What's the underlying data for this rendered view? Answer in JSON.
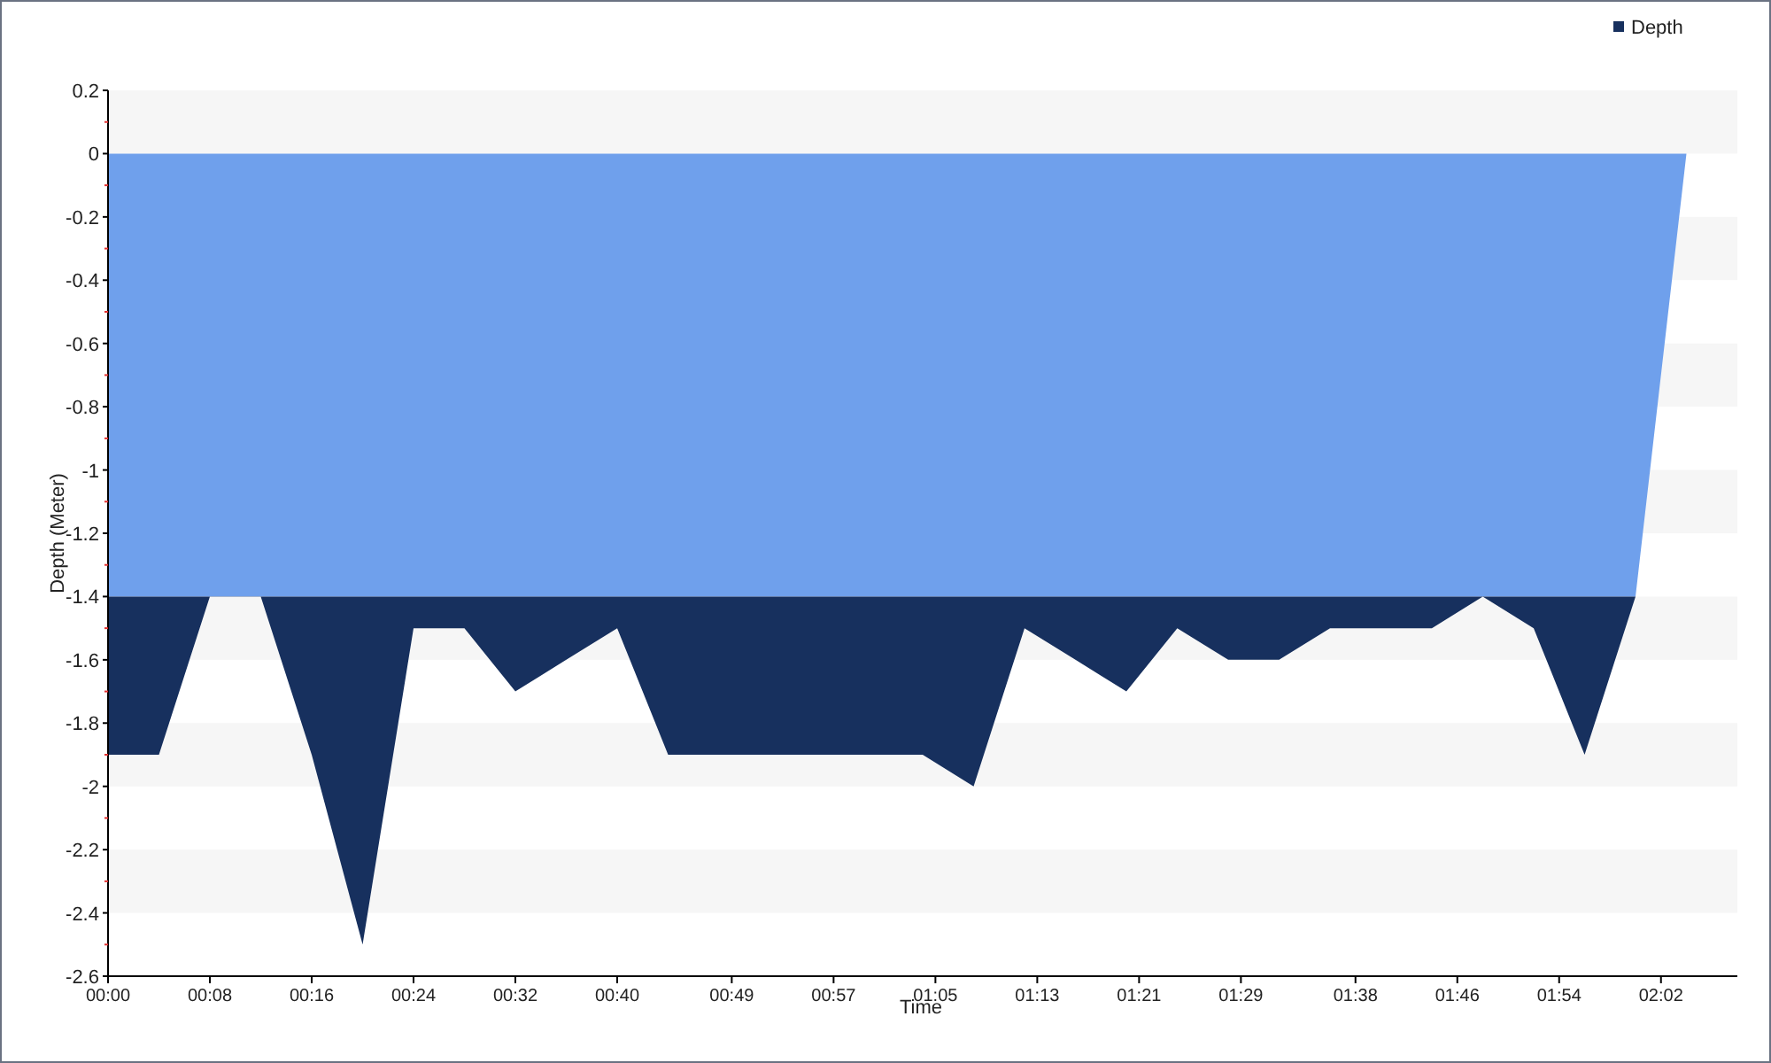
{
  "chart_data": {
    "type": "area",
    "xlabel": "Time",
    "ylabel": "Depth (Meter)",
    "xlim": [
      0,
      128
    ],
    "ylim": [
      -2.6,
      0.2
    ],
    "x": [
      0,
      4,
      8,
      12,
      16,
      20,
      24,
      28,
      32,
      36,
      40,
      44,
      48,
      52,
      56,
      60,
      64,
      68,
      72,
      76,
      80,
      84,
      88,
      92,
      96,
      100,
      104,
      108,
      112,
      116,
      120,
      124
    ],
    "series": [
      {
        "name": "Depth",
        "color": "#17305e",
        "values": [
          -1.9,
          -1.9,
          -1.4,
          -1.4,
          -1.9,
          -2.5,
          -1.5,
          -1.5,
          -1.7,
          -1.6,
          -1.5,
          -1.9,
          -1.9,
          -1.9,
          -1.9,
          -1.9,
          -1.9,
          -2.0,
          -1.5,
          -1.6,
          -1.7,
          -1.5,
          -1.6,
          -1.6,
          -1.5,
          -1.5,
          -1.5,
          -1.4,
          -1.5,
          -1.9,
          -1.4,
          0
        ]
      }
    ],
    "xticks": [
      {
        "value": 0,
        "label": "00:00"
      },
      {
        "value": 8,
        "label": "00:08"
      },
      {
        "value": 16,
        "label": "00:16"
      },
      {
        "value": 24,
        "label": "00:24"
      },
      {
        "value": 32,
        "label": "00:32"
      },
      {
        "value": 40,
        "label": "00:40"
      },
      {
        "value": 49,
        "label": "00:49"
      },
      {
        "value": 57,
        "label": "00:57"
      },
      {
        "value": 65,
        "label": "01:05"
      },
      {
        "value": 73,
        "label": "01:13"
      },
      {
        "value": 81,
        "label": "01:21"
      },
      {
        "value": 89,
        "label": "01:29"
      },
      {
        "value": 98,
        "label": "01:38"
      },
      {
        "value": 106,
        "label": "01:46"
      },
      {
        "value": 114,
        "label": "01:54"
      },
      {
        "value": 122,
        "label": "02:02"
      }
    ],
    "yticks": [
      0.2,
      0,
      -0.2,
      -0.4,
      -0.6,
      -0.8,
      {
        "value": -1,
        "label": "-1"
      },
      -1.2,
      -1.4,
      -1.6,
      -1.8,
      {
        "value": -2,
        "label": "-2"
      },
      -2.2,
      -2.4,
      -2.6
    ]
  }
}
